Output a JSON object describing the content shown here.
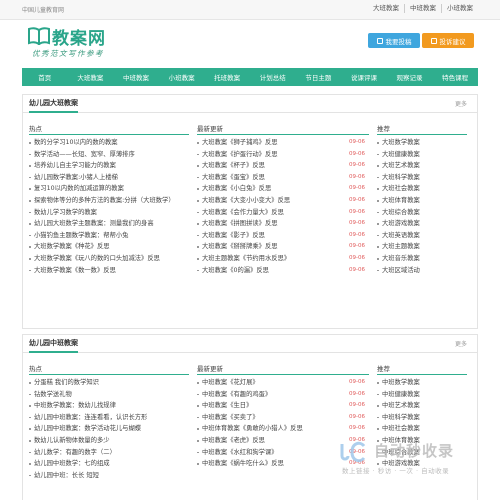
{
  "topbar": {
    "site_name": "中国儿童教育网",
    "links": [
      "大班教案",
      "中班教案",
      "小班教案"
    ]
  },
  "logo": {
    "title": "教案网",
    "slogan": "优秀范文写作参考"
  },
  "header_buttons": [
    {
      "label": "我要投稿",
      "icon": "edit-icon",
      "color": "#3fa6de"
    },
    {
      "label": "投诉建议",
      "icon": "mail-icon",
      "color": "#f29a1f"
    }
  ],
  "nav": [
    "首页",
    "大班教案",
    "中班教案",
    "小班教案",
    "托班教案",
    "计划总结",
    "节日主题",
    "说课评课",
    "观察记录",
    "特色课程"
  ],
  "colors": {
    "accent": "#2fae8e",
    "date": "#e05a5a"
  },
  "sections": [
    {
      "title": "幼儿园大班教案",
      "more": "更多",
      "hot_header": "热点",
      "latest_header": "最新更新",
      "rec_header": "推荐",
      "hot": [
        "数的分学习10以内的数的教案",
        "数学活动——长短、宽窄、厚薄排序",
        "培养幼儿自主学习能力的教案",
        "幼儿园数学教案:小猪人上楼梯",
        "复习10以内数的加减运算的教案",
        "探索物体等分的多种方法的教案:分拼（大班数学）",
        "数幼儿学习数学的教案",
        "幼儿园大班数学主题教案：测量我们的身高",
        "小猫钓鱼主题数学教案：帮帮小兔",
        "大班数学教案《种花》反思",
        "大班数学教案《玩八的数的口头加减法》反思",
        "大班数学教案《数一数》反思"
      ],
      "latest": [
        {
          "text": "大班教案《狮子捕鸡》反思",
          "date": "09-06"
        },
        {
          "text": "大班教案《护蛋行动》反思",
          "date": "09-06"
        },
        {
          "text": "大班教案《杯子》反思",
          "date": "09-06"
        },
        {
          "text": "大班教案《蛋宝》反思",
          "date": "09-06"
        },
        {
          "text": "大班教案《小白兔》反思",
          "date": "09-06"
        },
        {
          "text": "大班教案《大变小小变大》反思",
          "date": "09-06"
        },
        {
          "text": "大班教案《会作力量大》反思",
          "date": "09-06"
        },
        {
          "text": "大班教案《拼图拼读》反思",
          "date": "09-06"
        },
        {
          "text": "大班教案《影子》反思",
          "date": "09-06"
        },
        {
          "text": "大班教案《掰掰牌乘》反思",
          "date": "09-06"
        },
        {
          "text": "大班主题教案《节约用水反思》",
          "date": "09-06"
        },
        {
          "text": "大班教案《0的漏》反思",
          "date": "09-06"
        }
      ],
      "recommended": [
        "大班数学教案",
        "大班健康教案",
        "大班艺术教案",
        "大班科学教案",
        "大班社会教案",
        "大班体育教案",
        "大班综合教案",
        "大班游戏教案",
        "大班英语教案",
        "大班主题教案",
        "大班音乐教案",
        "大班区域活动"
      ]
    },
    {
      "title": "幼儿园中班教案",
      "more": "更多",
      "hot_header": "热点",
      "latest_header": "最新更新",
      "rec_header": "推荐",
      "hot": [
        "分蛋糕 我们的数学知识",
        "钻数学送礼物",
        "中班数学教案：数幼儿找规律",
        "幼儿园中班教案：连连看看，认识长方形",
        "幼儿园中班教案：数学活动花儿与蝴蝶",
        "数幼儿认新物体数量的多少",
        "幼儿数学：有趣的数字（二）",
        "幼儿园中班数学：七的组成",
        "幼儿园中班：长长 短短"
      ],
      "latest": [
        {
          "text": "中班教案《花灯展》",
          "date": "09-06"
        },
        {
          "text": "中班教案《有趣的鸡蛋》",
          "date": "09-06"
        },
        {
          "text": "中班教案《生日》",
          "date": "09-06"
        },
        {
          "text": "中班教案《买卖了》",
          "date": "09-06"
        },
        {
          "text": "中班体育教案《勇敢的小猎人》反思",
          "date": "09-06"
        },
        {
          "text": "中班教案《老虎》反思",
          "date": "09-06"
        },
        {
          "text": "中班教案《水红和狗学课》",
          "date": "09-06"
        },
        {
          "text": "中班教案《蜗牛吃什么》反思",
          "date": "09-06"
        }
      ],
      "recommended": [
        "中班数学教案",
        "中班健康教案",
        "中班艺术教案",
        "中班科学教案",
        "中班社会教案",
        "中班体育教案",
        "中班综合教案",
        "中班游戏教案"
      ]
    }
  ],
  "watermark": {
    "title": "自动秒收录",
    "subtitle": "数上链接 · 秒访 · 一次 · 自动收录"
  }
}
